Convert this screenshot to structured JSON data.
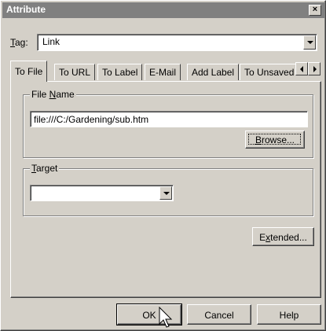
{
  "window": {
    "title": "Attribute",
    "close_symbol": "×"
  },
  "tag": {
    "label_prefix": "",
    "label_mnemonic": "T",
    "label_rest": "ag:",
    "value": "Link"
  },
  "tabs": [
    {
      "label": "To File",
      "active": true
    },
    {
      "label": "To URL",
      "active": false
    },
    {
      "label": "To Label",
      "active": false
    },
    {
      "label": "E-Mail",
      "active": false
    },
    {
      "label": "Add Label",
      "active": false
    },
    {
      "label": "To Unsaved D",
      "active": false
    }
  ],
  "file_name": {
    "title_prefix": "File ",
    "title_mnemonic": "N",
    "title_rest": "ame",
    "value": "file:///C:/Gardening/sub.htm",
    "browse_prefix": "",
    "browse_mnemonic": "B",
    "browse_rest": "rowse..."
  },
  "target": {
    "title_mnemonic": "T",
    "title_rest": "arget",
    "value": ""
  },
  "extended": {
    "prefix": "E",
    "mnemonic": "x",
    "rest": "tended..."
  },
  "footer": {
    "ok": "OK",
    "cancel": "Cancel",
    "help": "Help"
  }
}
